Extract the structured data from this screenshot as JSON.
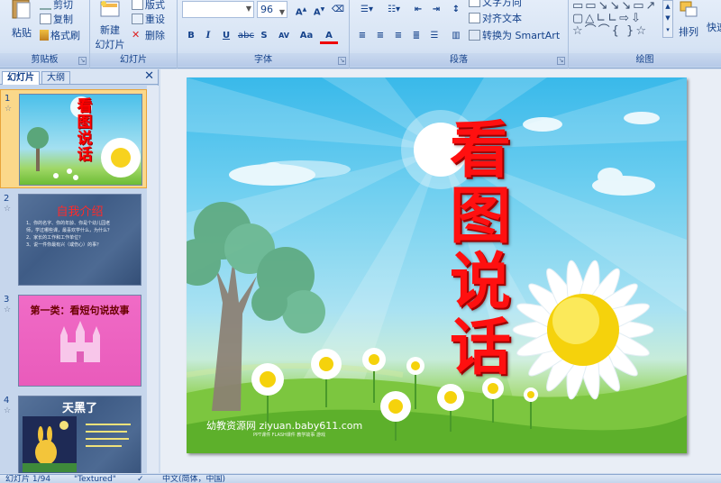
{
  "ribbon": {
    "clipboard": {
      "label": "剪贴板",
      "paste": "粘贴",
      "cut": "剪切",
      "copy": "复制",
      "format_painter": "格式刷"
    },
    "slides": {
      "label": "幻灯片",
      "new_slide": "新建",
      "new_slide_2": "幻灯片",
      "layout": "版式",
      "reset": "重设",
      "delete": "删除"
    },
    "font": {
      "label": "字体",
      "font_name": "",
      "font_size": "96",
      "bold": "B",
      "italic": "I",
      "underline": "U",
      "strike": "abc",
      "shadow": "S",
      "spacing": "AV",
      "case": "Aa",
      "color": "A"
    },
    "paragraph": {
      "label": "段落",
      "text_direction": "文字方向",
      "align_text": "对齐文本",
      "smartart": "转换为 SmartArt"
    },
    "drawing": {
      "label": "绘图",
      "arrange": "排列",
      "quick_styles": "快速"
    }
  },
  "panel": {
    "tabs": [
      "幻灯片",
      "大纲"
    ],
    "close": "✕",
    "slides": [
      {
        "num": "1",
        "title": "看图说话"
      },
      {
        "num": "2",
        "title": "自我介绍",
        "lines": [
          "1、你的名字、你的年龄、你是个幼儿园老",
          "师，学过哪些课，最喜欢学什么，为什么？",
          "2、家长的工作和工作单位？",
          "3、说一件你最有兴（或伤心）的事？"
        ]
      },
      {
        "num": "3",
        "title": "第一类：看短句说故事"
      },
      {
        "num": "4",
        "title": "天黑了"
      }
    ]
  },
  "slide": {
    "title_chars": [
      "看",
      "图",
      "说",
      "话"
    ],
    "watermark_main": "幼教资源网 ziyuan.baby611.com",
    "watermark_sub": "PPT课件  FLASH课件  教学故事  游戏"
  },
  "statusbar": {
    "slide_pos": "幻灯片 1/94",
    "theme": "\"Textured\"",
    "lang": "中文(简体，中国)"
  },
  "colors": {
    "ribbon_bg": "#d6e3f4",
    "title_red": "#ff1010",
    "selected_thumb": "#fbd88a"
  }
}
